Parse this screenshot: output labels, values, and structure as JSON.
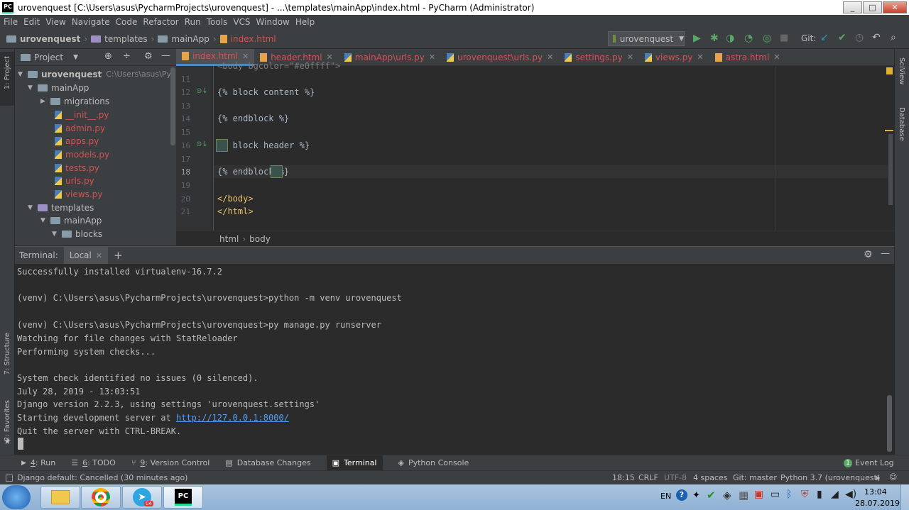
{
  "window": {
    "app_icon": "PC",
    "title": "urovenquest [C:\\Users\\asus\\PycharmProjects\\urovenquest] - ...\\templates\\mainApp\\index.html - PyCharm (Administrator)",
    "minimize": "_",
    "maximize": "□",
    "close": "✕"
  },
  "menu": [
    "File",
    "Edit",
    "View",
    "Navigate",
    "Code",
    "Refactor",
    "Run",
    "Tools",
    "VCS",
    "Window",
    "Help"
  ],
  "navbar": {
    "crumbs": [
      "urovenquest",
      "templates",
      "mainApp",
      "index.html"
    ],
    "run_config": "urovenquest",
    "git_label": "Git:"
  },
  "left_strip": {
    "project": "1: Project",
    "structure": "7: Structure",
    "favorites": "2: Favorites"
  },
  "right_strip": {
    "sciview": "SciView",
    "database": "Database"
  },
  "project_panel": {
    "title": "Project",
    "root_name": "urovenquest",
    "root_path": "C:\\Users\\asus\\Pycharm",
    "items": [
      {
        "label": "mainApp",
        "type": "folder",
        "level": 1,
        "expanded": true
      },
      {
        "label": "migrations",
        "type": "folder",
        "level": 2,
        "expanded": false
      },
      {
        "label": "__init__.py",
        "type": "py",
        "level": 2
      },
      {
        "label": "admin.py",
        "type": "py",
        "level": 2
      },
      {
        "label": "apps.py",
        "type": "py",
        "level": 2
      },
      {
        "label": "models.py",
        "type": "py",
        "level": 2
      },
      {
        "label": "tests.py",
        "type": "py",
        "level": 2
      },
      {
        "label": "urls.py",
        "type": "py",
        "level": 2
      },
      {
        "label": "views.py",
        "type": "py",
        "level": 2
      },
      {
        "label": "templates",
        "type": "folder-purple",
        "level": 1,
        "expanded": true
      },
      {
        "label": "mainApp",
        "type": "folder",
        "level": 2,
        "expanded": true
      },
      {
        "label": "blocks",
        "type": "folder",
        "level": 3,
        "expanded": true
      }
    ]
  },
  "editor": {
    "tabs": [
      {
        "label": "index.html",
        "icon": "html",
        "active": true
      },
      {
        "label": "header.html",
        "icon": "html",
        "active": false
      },
      {
        "label": "mainApp\\urls.py",
        "icon": "py",
        "active": false
      },
      {
        "label": "urovenquest\\urls.py",
        "icon": "py",
        "active": false
      },
      {
        "label": "settings.py",
        "icon": "py",
        "active": false
      },
      {
        "label": "views.py",
        "icon": "py",
        "active": false
      },
      {
        "label": "astra.html",
        "icon": "html",
        "active": false
      }
    ],
    "lines": [
      {
        "n": "11",
        "text": ""
      },
      {
        "n": "12",
        "text": "{% block content %}"
      },
      {
        "n": "13",
        "text": ""
      },
      {
        "n": "14",
        "text": "{% endblock %}"
      },
      {
        "n": "15",
        "text": ""
      },
      {
        "n": "16",
        "text": "{% block header %}"
      },
      {
        "n": "17",
        "text": ""
      },
      {
        "n": "18",
        "text": "{% endblock %}"
      },
      {
        "n": "19",
        "text": ""
      },
      {
        "n": "20",
        "text": "</body>"
      },
      {
        "n": "21",
        "text": "</html>"
      }
    ],
    "partial_top": "<body bgcolor=\"#e0ffff\">",
    "breadcrumbs": [
      "html",
      "body"
    ]
  },
  "terminal": {
    "title": "Terminal:",
    "tab": "Local",
    "add": "+",
    "lines": [
      "Successfully installed virtualenv-16.7.2",
      "",
      "(venv) C:\\Users\\asus\\PycharmProjects\\urovenquest>python -m venv urovenquest",
      "",
      "(venv) C:\\Users\\asus\\PycharmProjects\\urovenquest>py manage.py runserver",
      "Watching for file changes with StatReloader",
      "Performing system checks...",
      "",
      "System check identified no issues (0 silenced).",
      "July 28, 2019 - 13:03:51",
      "Django version 2.2.3, using settings 'urovenquest.settings'",
      "Starting development server at ",
      "Quit the server with CTRL-BREAK."
    ],
    "server_url": "http://127.0.0.1:8000/"
  },
  "tool_windows": [
    {
      "num": "4",
      "label": ": Run",
      "icon": "▶"
    },
    {
      "num": "6",
      "label": ": TODO",
      "icon": "☰"
    },
    {
      "num": "9",
      "label": ": Version Control",
      "icon": "⑂"
    },
    {
      "num": "",
      "label": "Database Changes",
      "icon": "▤"
    },
    {
      "num": "",
      "label": "Terminal",
      "icon": "▣",
      "active": true
    },
    {
      "num": "",
      "label": "Python Console",
      "icon": "◈"
    }
  ],
  "event_log": {
    "badge": "1",
    "label": "Event Log"
  },
  "status": {
    "message": "Django default: Cancelled (30 minutes ago)",
    "position": "18:15",
    "line_sep": "CRLF",
    "encoding": "UTF-8",
    "indent": "4 spaces",
    "git": "Git: master",
    "interpreter": "Python 3.7 (urovenquest)"
  },
  "taskbar": {
    "lang": "EN",
    "time": "13:04",
    "date": "28.07.2019",
    "telegram_badge": "04"
  }
}
